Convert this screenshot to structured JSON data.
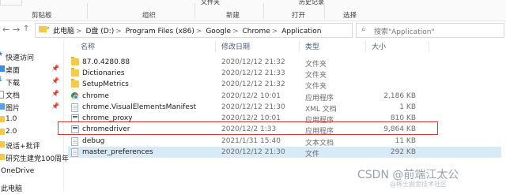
{
  "ribbon": {
    "top_tab": "文件夹",
    "top_tab2": "历史记录",
    "groups": [
      "剪贴板",
      "组织",
      "新建",
      "打开",
      "选择"
    ]
  },
  "address": {
    "back_icon": "left-arrow-icon",
    "forward_icon": "right-arrow-icon",
    "up_icon": "up-arrow-icon",
    "crumbs": [
      "此电脑",
      "D盘 (D:)",
      "Program Files (x86)",
      "Google",
      "Chrome",
      "Application"
    ],
    "separator": ">"
  },
  "search": {
    "placeholder": "搜索\"Application\""
  },
  "sidebar": {
    "items": [
      {
        "label": "快速访问",
        "pinned": false
      },
      {
        "label": "桌面",
        "pinned": true
      },
      {
        "label": "下载",
        "pinned": true
      },
      {
        "label": "文档",
        "pinned": true
      },
      {
        "label": "图片",
        "pinned": true
      },
      {
        "label": "1.0",
        "pinned": false
      },
      {
        "label": "2.0",
        "pinned": false
      },
      {
        "label": "说话+批评",
        "pinned": false
      },
      {
        "label": "研究生建党100周年",
        "pinned": false
      },
      {
        "label": "OneDrive",
        "pinned": false
      },
      {
        "label": "此电脑",
        "pinned": false
      }
    ],
    "pin_glyph": "📌"
  },
  "columns": {
    "name": "名称",
    "date": "修改日期",
    "type": "类型",
    "size": "大小"
  },
  "files": [
    {
      "name": "87.0.4280.88",
      "date": "2020/12/12 21:32",
      "type": "文件夹",
      "size": "",
      "icon": "folder"
    },
    {
      "name": "Dictionaries",
      "date": "2020/12/12 21:33",
      "type": "文件夹",
      "size": "",
      "icon": "folder"
    },
    {
      "name": "SetupMetrics",
      "date": "2020/12/12 21:32",
      "type": "文件夹",
      "size": "",
      "icon": "folder"
    },
    {
      "name": "chrome",
      "date": "2020/12/2 10:01",
      "type": "应用程序",
      "size": "2,186 KB",
      "icon": "chrome"
    },
    {
      "name": "chrome.VisualElementsManifest",
      "date": "2020/12/12 21:30",
      "type": "XML 文档",
      "size": "1 KB",
      "icon": "file"
    },
    {
      "name": "chrome_proxy",
      "date": "2020/12/2 10:01",
      "type": "应用程序",
      "size": "810 KB",
      "icon": "exe"
    },
    {
      "name": "chromedriver",
      "date": "2020/12/2 1:33",
      "type": "应用程序",
      "size": "9,864 KB",
      "icon": "exe"
    },
    {
      "name": "debug",
      "date": "2021/1/31 15:40",
      "type": "文本文档",
      "size": "11 KB",
      "icon": "file"
    },
    {
      "name": "master_preferences",
      "date": "2020/12/12 21:30",
      "type": "文件",
      "size": "292 KB",
      "icon": "file"
    }
  ],
  "watermark": {
    "main": "CSDN @前端江太公",
    "sub": "@稀土掘金技术社区"
  }
}
